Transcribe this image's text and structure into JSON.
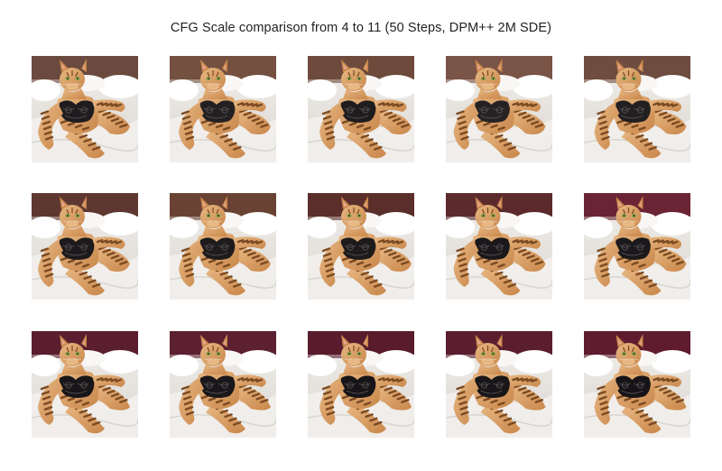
{
  "title": "CFG Scale comparison from 4 to 11 (50 Steps, DPM++ 2M SDE)",
  "grid": {
    "rows": 3,
    "columns": 5,
    "images": [
      {
        "subject": "tabby-cat-figure-on-bed",
        "headboard": "#6a4a3e",
        "lace": "#1e1c1e"
      },
      {
        "subject": "tabby-cat-figure-on-bed",
        "headboard": "#735040",
        "lace": "#232022"
      },
      {
        "subject": "tabby-cat-figure-on-bed",
        "headboard": "#6e4a3c",
        "lace": "#1f1c1e"
      },
      {
        "subject": "tabby-cat-figure-on-bed",
        "headboard": "#7a5446",
        "lace": "#262224"
      },
      {
        "subject": "tabby-cat-figure-on-bed",
        "headboard": "#6e4c40",
        "lace": "#221f21"
      },
      {
        "subject": "tabby-cat-figure-on-bed",
        "headboard": "#5e3830",
        "lace": "#1c1a1c"
      },
      {
        "subject": "tabby-cat-figure-on-bed",
        "headboard": "#6a4234",
        "lace": "#1e1b1d"
      },
      {
        "subject": "tabby-cat-figure-on-bed",
        "headboard": "#5a2e2a",
        "lace": "#1d1a1c"
      },
      {
        "subject": "tabby-cat-figure-on-bed",
        "headboard": "#5c2a2c",
        "lace": "#1a181a"
      },
      {
        "subject": "tabby-cat-figure-on-bed",
        "headboard": "#6a2434",
        "lace": "#1b191b"
      },
      {
        "subject": "tabby-cat-figure-on-bed",
        "headboard": "#5a1e2e",
        "lace": "#181618"
      },
      {
        "subject": "tabby-cat-figure-on-bed",
        "headboard": "#5c2030",
        "lace": "#191719"
      },
      {
        "subject": "tabby-cat-figure-on-bed",
        "headboard": "#581c2c",
        "lace": "#171517"
      },
      {
        "subject": "tabby-cat-figure-on-bed",
        "headboard": "#5a1e2e",
        "lace": "#181618"
      },
      {
        "subject": "tabby-cat-figure-on-bed",
        "headboard": "#5e1c2e",
        "lace": "#161416"
      }
    ]
  },
  "colors": {
    "fur": "#c9874a",
    "fur_dark": "#7a4a22",
    "fur_light": "#e8b884",
    "sheet": "#f3f1ee",
    "sheet_shadow": "#d9d5cf",
    "pillow": "#ffffff",
    "eye": "#8aa04a"
  }
}
